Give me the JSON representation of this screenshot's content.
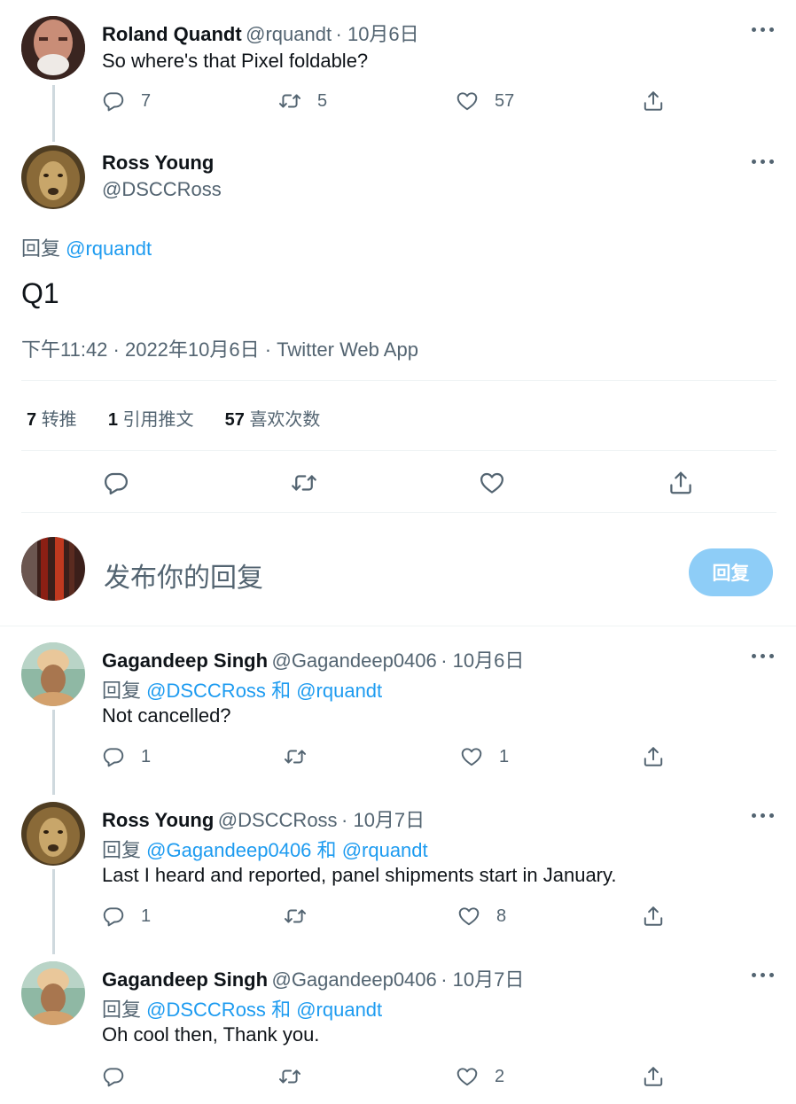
{
  "parent_tweet": {
    "name": "Roland Quandt",
    "handle": "@rquandt",
    "date": "· 10月6日",
    "text": "So where's that Pixel foldable?",
    "replies": "7",
    "retweets": "5",
    "likes": "57"
  },
  "main_tweet": {
    "name": "Ross Young",
    "handle": "@DSCCRoss",
    "reply_prefix": "回复",
    "reply_to": "@rquandt",
    "text": "Q1",
    "timestamp": "下午11:42 · 2022年10月6日 · Twitter Web App",
    "stats": {
      "retweets_count": "7",
      "retweets_label": "转推",
      "quotes_count": "1",
      "quotes_label": "引用推文",
      "likes_count": "57",
      "likes_label": "喜欢次数"
    }
  },
  "compose": {
    "placeholder": "发布你的回复",
    "button": "回复"
  },
  "replies": [
    {
      "name": "Gagandeep Singh",
      "handle": "@Gagandeep0406",
      "date": "· 10月6日",
      "reply_prefix": "回复",
      "reply_to_1": "@DSCCRoss",
      "reply_and": "和",
      "reply_to_2": "@rquandt",
      "text": "Not cancelled?",
      "replies": "1",
      "retweets": "",
      "likes": "1"
    },
    {
      "name": "Ross Young",
      "handle": "@DSCCRoss",
      "date": "· 10月7日",
      "reply_prefix": "回复",
      "reply_to_1": "@Gagandeep0406",
      "reply_and": "和",
      "reply_to_2": "@rquandt",
      "text": "Last I heard and reported, panel shipments start in January.",
      "replies": "1",
      "retweets": "",
      "likes": "8"
    },
    {
      "name": "Gagandeep Singh",
      "handle": "@Gagandeep0406",
      "date": "· 10月7日",
      "reply_prefix": "回复",
      "reply_to_1": "@DSCCRoss",
      "reply_and": "和",
      "reply_to_2": "@rquandt",
      "text": "Oh cool then, Thank you.",
      "replies": "",
      "retweets": "",
      "likes": "2"
    }
  ],
  "icons": {
    "reply": "reply-icon",
    "retweet": "retweet-icon",
    "like": "heart-icon",
    "share": "share-icon",
    "more": "more-icon"
  },
  "colors": {
    "link": "#1d9bf0",
    "muted": "#536471",
    "button_disabled": "#8ecdf7"
  }
}
